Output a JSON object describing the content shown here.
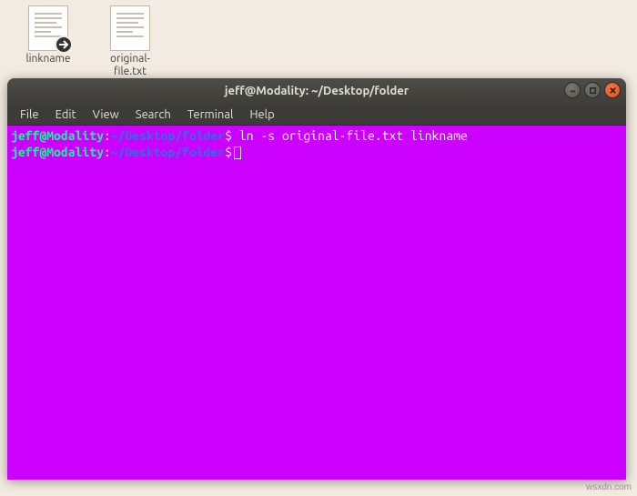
{
  "desktop": {
    "icons": [
      {
        "label": "linkname",
        "is_link": true
      },
      {
        "label": "original-file.txt",
        "is_link": false
      }
    ]
  },
  "window": {
    "title": "jeff@Modality: ~/Desktop/folder",
    "menu": [
      "File",
      "Edit",
      "View",
      "Search",
      "Terminal",
      "Help"
    ],
    "controls": {
      "minimize": "minimize",
      "maximize": "maximize",
      "close": "close"
    }
  },
  "terminal": {
    "prompt_user_host": "jeff@Modality",
    "prompt_sep": ":",
    "prompt_path": "~/Desktop/folder",
    "prompt_symbol": "$",
    "lines": [
      {
        "cmd": "ln -s original-file.txt linkname"
      },
      {
        "cmd": ""
      }
    ]
  },
  "watermark": "wsxdn.com"
}
